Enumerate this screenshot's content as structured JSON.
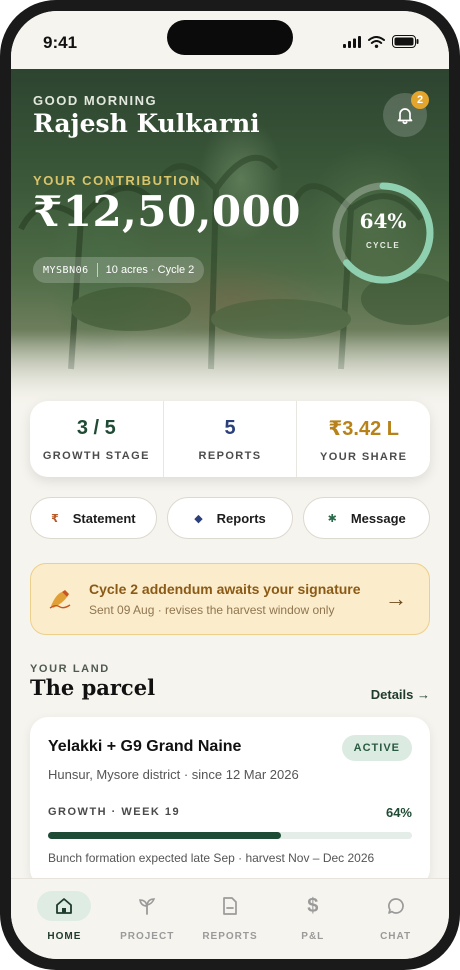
{
  "status_bar": {
    "time": "9:41"
  },
  "header": {
    "greeting": "GOOD MORNING",
    "user_name": "Rajesh Kulkarni",
    "notification_count": "2"
  },
  "contribution": {
    "label": "YOUR CONTRIBUTION",
    "amount": "₹12,50,000",
    "plot_id": "MYSBN06",
    "plot_info": "10 acres · Cycle 2",
    "cycle_progress": 0.64,
    "cycle_percent": "64%",
    "cycle_label": "CYCLE"
  },
  "stats": [
    {
      "value": "3 / 5",
      "label": "GROWTH STAGE",
      "color": "#1f4b34"
    },
    {
      "value": "5",
      "label": "REPORTS",
      "color": "#2b3f7a"
    },
    {
      "value": "₹3.42 L",
      "label": "YOUR SHARE",
      "color": "#b7821a"
    }
  ],
  "actions": [
    {
      "label": "Statement",
      "icon": "rupee-icon",
      "glyph": "₹",
      "color": "#b65a2a"
    },
    {
      "label": "Reports",
      "icon": "diamond-icon",
      "glyph": "◆",
      "color": "#2b3f7a"
    },
    {
      "label": "Message",
      "icon": "asterisk-icon",
      "glyph": "✱",
      "color": "#2a6a4a"
    }
  ],
  "banner": {
    "title": "Cycle 2 addendum awaits your signature",
    "subtitle": "Sent 09 Aug · revises the harvest window only",
    "arrow": "→"
  },
  "land_section": {
    "label": "YOUR LAND",
    "title": "The parcel",
    "details_link": "Details →"
  },
  "parcel": {
    "title": "Yelakki + G9 Grand Naine",
    "status": "ACTIVE",
    "location": "Hunsur, Mysore district · since 12 Mar 2026",
    "growth_label": "GROWTH · WEEK 19",
    "growth_percent": "64%",
    "growth_progress": 0.64,
    "note": "Bunch formation expected late Sep · harvest Nov – Dec 2026"
  },
  "tabs": [
    {
      "label": "HOME",
      "icon": "home-icon",
      "active": true
    },
    {
      "label": "PROJECT",
      "icon": "sprout-icon",
      "active": false
    },
    {
      "label": "REPORTS",
      "icon": "document-icon",
      "active": false
    },
    {
      "label": "P&L",
      "icon": "dollar-icon",
      "active": false
    },
    {
      "label": "CHAT",
      "icon": "chat-icon",
      "active": false
    }
  ]
}
